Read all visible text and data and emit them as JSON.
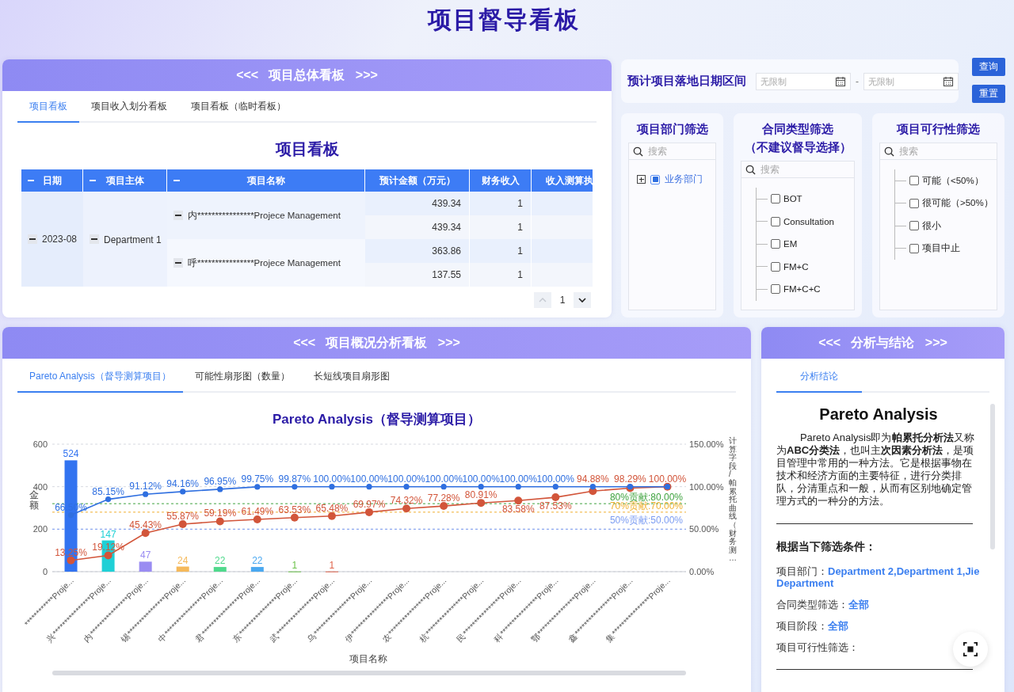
{
  "page_title": "项目督导看板",
  "overview_panel": {
    "header": "<<<   项目总体看板   >>>",
    "tabs": [
      {
        "label": "项目看板",
        "selected": true
      },
      {
        "label": "项目收入划分看板",
        "selected": false
      },
      {
        "label": "项目看板（临时看板）",
        "selected": false
      }
    ],
    "table_title": "项目看板",
    "table": {
      "columns": [
        {
          "label": "日期",
          "collapsible": true
        },
        {
          "label": "项目主体",
          "collapsible": true
        },
        {
          "label": "项目名称",
          "collapsible": true
        },
        {
          "label": "预计金额（万元）",
          "collapsible": false
        },
        {
          "label": "财务收入",
          "collapsible": false
        },
        {
          "label": "收入测算执",
          "collapsible": false
        }
      ],
      "groups": [
        {
          "date": "2023-08",
          "expanded": true,
          "entities": [
            {
              "name": "Department 1",
              "expanded": true,
              "projects": [
                {
                  "name": "内****************Projece Management",
                  "expanded": true,
                  "rows": [
                    {
                      "amount": "439.34",
                      "income": "1"
                    },
                    {
                      "amount": "439.34",
                      "income": "1"
                    }
                  ]
                },
                {
                  "name": "呼****************Projece Management",
                  "expanded": true,
                  "rows": [
                    {
                      "amount": "363.86",
                      "income": "1"
                    },
                    {
                      "amount": "137.55",
                      "income": "1"
                    }
                  ]
                }
              ]
            }
          ]
        }
      ]
    },
    "pagination": {
      "page": "1",
      "prev_disabled": true,
      "next_disabled": false
    }
  },
  "date_filter": {
    "label": "预计项目落地日期区间",
    "start": {
      "placeholder": "无限制"
    },
    "separator": "-",
    "end": {
      "placeholder": "无限制"
    }
  },
  "buttons": [
    {
      "label": "查询"
    },
    {
      "label": "重置"
    }
  ],
  "filters": [
    {
      "title": "项目部门筛选",
      "kind": "tree",
      "search": {
        "placeholder": "搜索"
      },
      "items": [
        {
          "label": "业务部门",
          "checked": false,
          "indeterminate": true,
          "expanded": false
        }
      ]
    },
    {
      "title": "合同类型筛选",
      "subtitle": "（不建议督导选择）",
      "kind": "checklist",
      "search": {
        "placeholder": "搜索"
      },
      "items": [
        {
          "label": "BOT",
          "checked": false
        },
        {
          "label": "Consultation",
          "checked": false
        },
        {
          "label": "EM",
          "checked": false
        },
        {
          "label": "FM+C",
          "checked": false
        },
        {
          "label": "FM+C+C",
          "checked": false
        }
      ]
    },
    {
      "title": "项目可行性筛选",
      "kind": "checklist",
      "search": {
        "placeholder": "搜索"
      },
      "items": [
        {
          "label": "可能（<50%）",
          "checked": false
        },
        {
          "label": "很可能（>50%）",
          "checked": false
        },
        {
          "label": "很小",
          "checked": false
        },
        {
          "label": "项目中止",
          "checked": false
        }
      ]
    }
  ],
  "analysis_panel": {
    "header": "<<<   项目概况分析看板   >>>",
    "tabs": [
      {
        "label": "Pareto Analysis（督导测算项目）",
        "selected": true
      },
      {
        "label": "可能性扇形图（数量）",
        "selected": false
      },
      {
        "label": "长短线项目扇形图",
        "selected": false
      }
    ],
    "chart_title": "Pareto Analysis（督导测算项目）",
    "chart_data": {
      "type": "bar",
      "xlabel": "项目名称",
      "ylabel": "金额",
      "y2label": "计算字段/帕累托曲线（财务测…",
      "categories": [
        "************Proje...",
        "兴****************Proje...",
        "内****************Proje...",
        "锡****************Proje...",
        "中****************Proje...",
        "君****************Proje...",
        "东****************Proje...",
        "武****************Proje...",
        "乌****************Proje...",
        "伊****************Proje...",
        "农****************Proje...",
        "杭****************Proje...",
        "民****************Proje...",
        "科****************Proje...",
        "鄂****************Proje...",
        "鑫****************Proje...",
        "集****************Proje..."
      ],
      "series": [
        {
          "type": "bar",
          "colors": [
            "#3273f0",
            "#1fd0d6",
            "#9a8cf2",
            "#f5b95a",
            "#4fd98c",
            "#4aa8f0",
            "#6cc24a",
            "#e0634a",
            null,
            null,
            null,
            null,
            null,
            null,
            null,
            null,
            null
          ],
          "values": [
            524,
            147,
            47,
            24,
            22,
            22,
            1,
            1,
            null,
            null,
            null,
            null,
            null,
            null,
            null,
            null,
            null
          ],
          "value_labels": [
            "524",
            "147",
            "47",
            "24",
            "22",
            "22",
            "1",
            "1",
            null,
            null,
            null,
            null,
            null,
            null,
            null,
            null,
            null
          ]
        },
        {
          "type": "line",
          "axis": "y2",
          "marker": "circle",
          "color": "#2f6fe0",
          "values": [
            66.5,
            85.15,
            91.12,
            94.16,
            96.95,
            99.75,
            99.87,
            100,
            100,
            100,
            100,
            100,
            100,
            100,
            100,
            100,
            100
          ],
          "value_labels": [
            "66.50%",
            "85.15%",
            "91.12%",
            "94.16%",
            "96.95%",
            "99.75%",
            "99.87%",
            "100.00%",
            "100.00%",
            "100.00%",
            "100.00%",
            "100.00%",
            "100.00%",
            "100.00%",
            null,
            null,
            null
          ]
        },
        {
          "type": "line",
          "axis": "y2",
          "marker": "circle",
          "color": "#d2553a",
          "values": [
            13.25,
            19.12,
            45.43,
            55.87,
            59.19,
            61.49,
            63.53,
            65.48,
            69.97,
            74.32,
            77.28,
            80.91,
            83.58,
            87.53,
            94.88,
            98.29,
            100
          ],
          "value_labels": [
            "13.25%",
            "19.12%",
            "45.43%",
            "55.87%",
            "59.19%",
            "61.49%",
            "63.53%",
            "65.48%",
            "69.97%",
            "74.32%",
            "77.28%",
            "80.91%",
            "83.58%",
            "87.53%",
            "94.88%",
            "98.29%",
            "100.00%"
          ]
        }
      ],
      "ylim": [
        0,
        600
      ],
      "yticks": [
        0,
        200,
        400,
        600
      ],
      "y2lim": [
        0,
        150
      ],
      "y2ticks": [
        {
          "value": 0,
          "label": "0.00%"
        },
        {
          "value": 50,
          "label": "50.00%"
        },
        {
          "value": 100,
          "label": "100.00%"
        },
        {
          "value": 150,
          "label": "150.00%"
        }
      ],
      "ref_lines": [
        {
          "axis": "y2",
          "value": 80,
          "label": "80%贡献:80.00%",
          "color": "#3fa33f"
        },
        {
          "axis": "y2",
          "value": 70,
          "label": "70%贡献:70.00%",
          "color": "#f0b030"
        },
        {
          "axis": "y2",
          "value": 50,
          "label": "50%贡献:50.00%",
          "color": "#7b9cf2"
        }
      ]
    }
  },
  "conclusion_panel": {
    "header": "<<<   分析与结论   >>>",
    "tabs": [
      {
        "label": "分析结论",
        "selected": true
      }
    ],
    "title": "Pareto Analysis",
    "paragraph": "Pareto Analysis即为**帕累托分析法**又称为**ABC分类法**，也叫主**次因素分析法**，是项目管理中常用的一种方法。它是根据事物在技术和经济方面的主要特征，进行分类排队，分清重点和一般，从而有区别地确定管理方式的一种分的方法。",
    "conditions_title": "根据当下筛选条件：",
    "conditions": [
      "项目部门：**Department 2,Department 1,Jie Department**",
      "合同类型筛选：**全部**",
      "项目阶段：**全部**",
      "项目可行性筛选："
    ]
  }
}
